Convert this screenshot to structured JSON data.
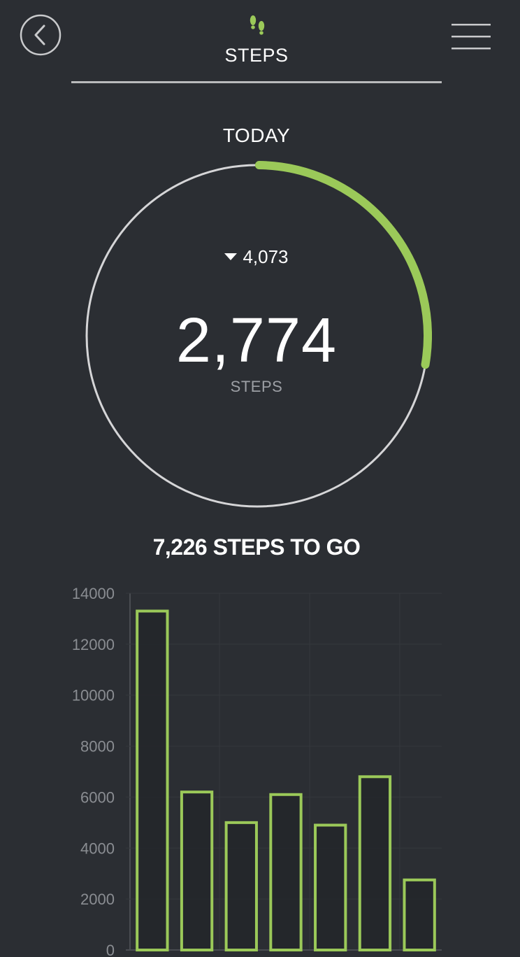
{
  "header": {
    "title": "STEPS",
    "back_icon": "chevron-left-icon",
    "menu_icon": "hamburger-menu-icon",
    "activity_icon": "footprints-icon"
  },
  "summary": {
    "period": "TODAY",
    "delta": "4,073",
    "delta_direction": "down",
    "count": "2,774",
    "unit": "STEPS",
    "progress": 0.277,
    "to_go": "7,226 STEPS TO GO"
  },
  "colors": {
    "background": "#2b2e33",
    "accent": "#9bc959",
    "ring_track": "#d5d5d7"
  },
  "chart_data": {
    "type": "bar",
    "categories": [
      "",
      "",
      "",
      "",
      "",
      "",
      ""
    ],
    "values": [
      13300,
      6200,
      5000,
      6100,
      4900,
      6800,
      2750
    ],
    "yticks": [
      "0",
      "2000",
      "4000",
      "6000",
      "8000",
      "10000",
      "12000",
      "14000"
    ],
    "ylim": [
      0,
      14000
    ],
    "grid": true,
    "bar_style": "outlined"
  }
}
